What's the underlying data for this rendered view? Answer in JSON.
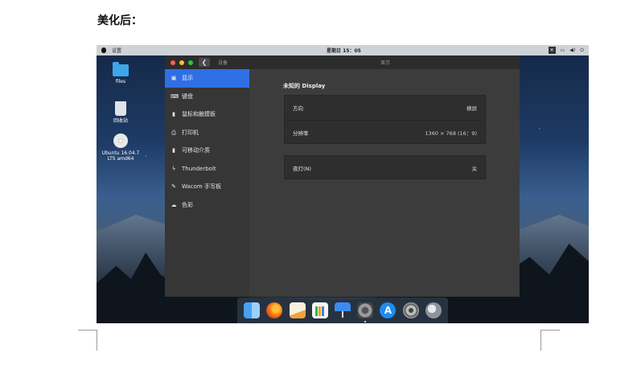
{
  "document": {
    "heading": "美化后："
  },
  "topbar": {
    "app_name": "设置",
    "clock": "星期日 15：05",
    "tray_badge": "✕",
    "tray_battery": "▭",
    "tray_volume": "◀)",
    "tray_power": "⏻"
  },
  "desktop": {
    "icons": [
      {
        "label": "files",
        "icon": "folder-icon"
      },
      {
        "label": "回收站",
        "icon": "trash-icon"
      },
      {
        "label": "Ubuntu 16.04.7 LTS amd64",
        "icon": "disc-icon"
      }
    ]
  },
  "window": {
    "back_glyph": "❮",
    "title_left": "设备",
    "title_center": "显示",
    "sidebar": {
      "items": [
        {
          "label": "显示",
          "icon": "display-icon",
          "glyph": "▣",
          "active": true
        },
        {
          "label": "键盘",
          "icon": "keyboard-icon",
          "glyph": "⌨",
          "active": false
        },
        {
          "label": "鼠标和触摸板",
          "icon": "mouse-icon",
          "glyph": "▮",
          "active": false
        },
        {
          "label": "打印机",
          "icon": "printer-icon",
          "glyph": "⎙",
          "active": false
        },
        {
          "label": "可移动介质",
          "icon": "usb-icon",
          "glyph": "▮",
          "active": false
        },
        {
          "label": "Thunderbolt",
          "icon": "thunderbolt-icon",
          "glyph": "ϟ",
          "active": false
        },
        {
          "label": "Wacom 手写板",
          "icon": "wacom-icon",
          "glyph": "✎",
          "active": false
        },
        {
          "label": "色彩",
          "icon": "color-icon",
          "glyph": "☁",
          "active": false
        }
      ]
    },
    "content": {
      "section_title": "未知的 Display",
      "rows": [
        {
          "label": "方向",
          "value": "横屏"
        },
        {
          "label": "分辨率",
          "value": "1360 × 768 (16：9)"
        }
      ],
      "night_light": {
        "label": "夜灯(N)",
        "value": "关"
      }
    }
  },
  "dock": {
    "items": [
      {
        "name": "finder-icon"
      },
      {
        "name": "firefox-icon"
      },
      {
        "name": "pages-icon"
      },
      {
        "name": "numbers-icon"
      },
      {
        "name": "keynote-icon"
      },
      {
        "name": "system-preferences-icon"
      },
      {
        "name": "app-store-icon",
        "glyph": "A"
      },
      {
        "name": "settings-icon"
      },
      {
        "name": "launchpad-icon"
      }
    ]
  }
}
